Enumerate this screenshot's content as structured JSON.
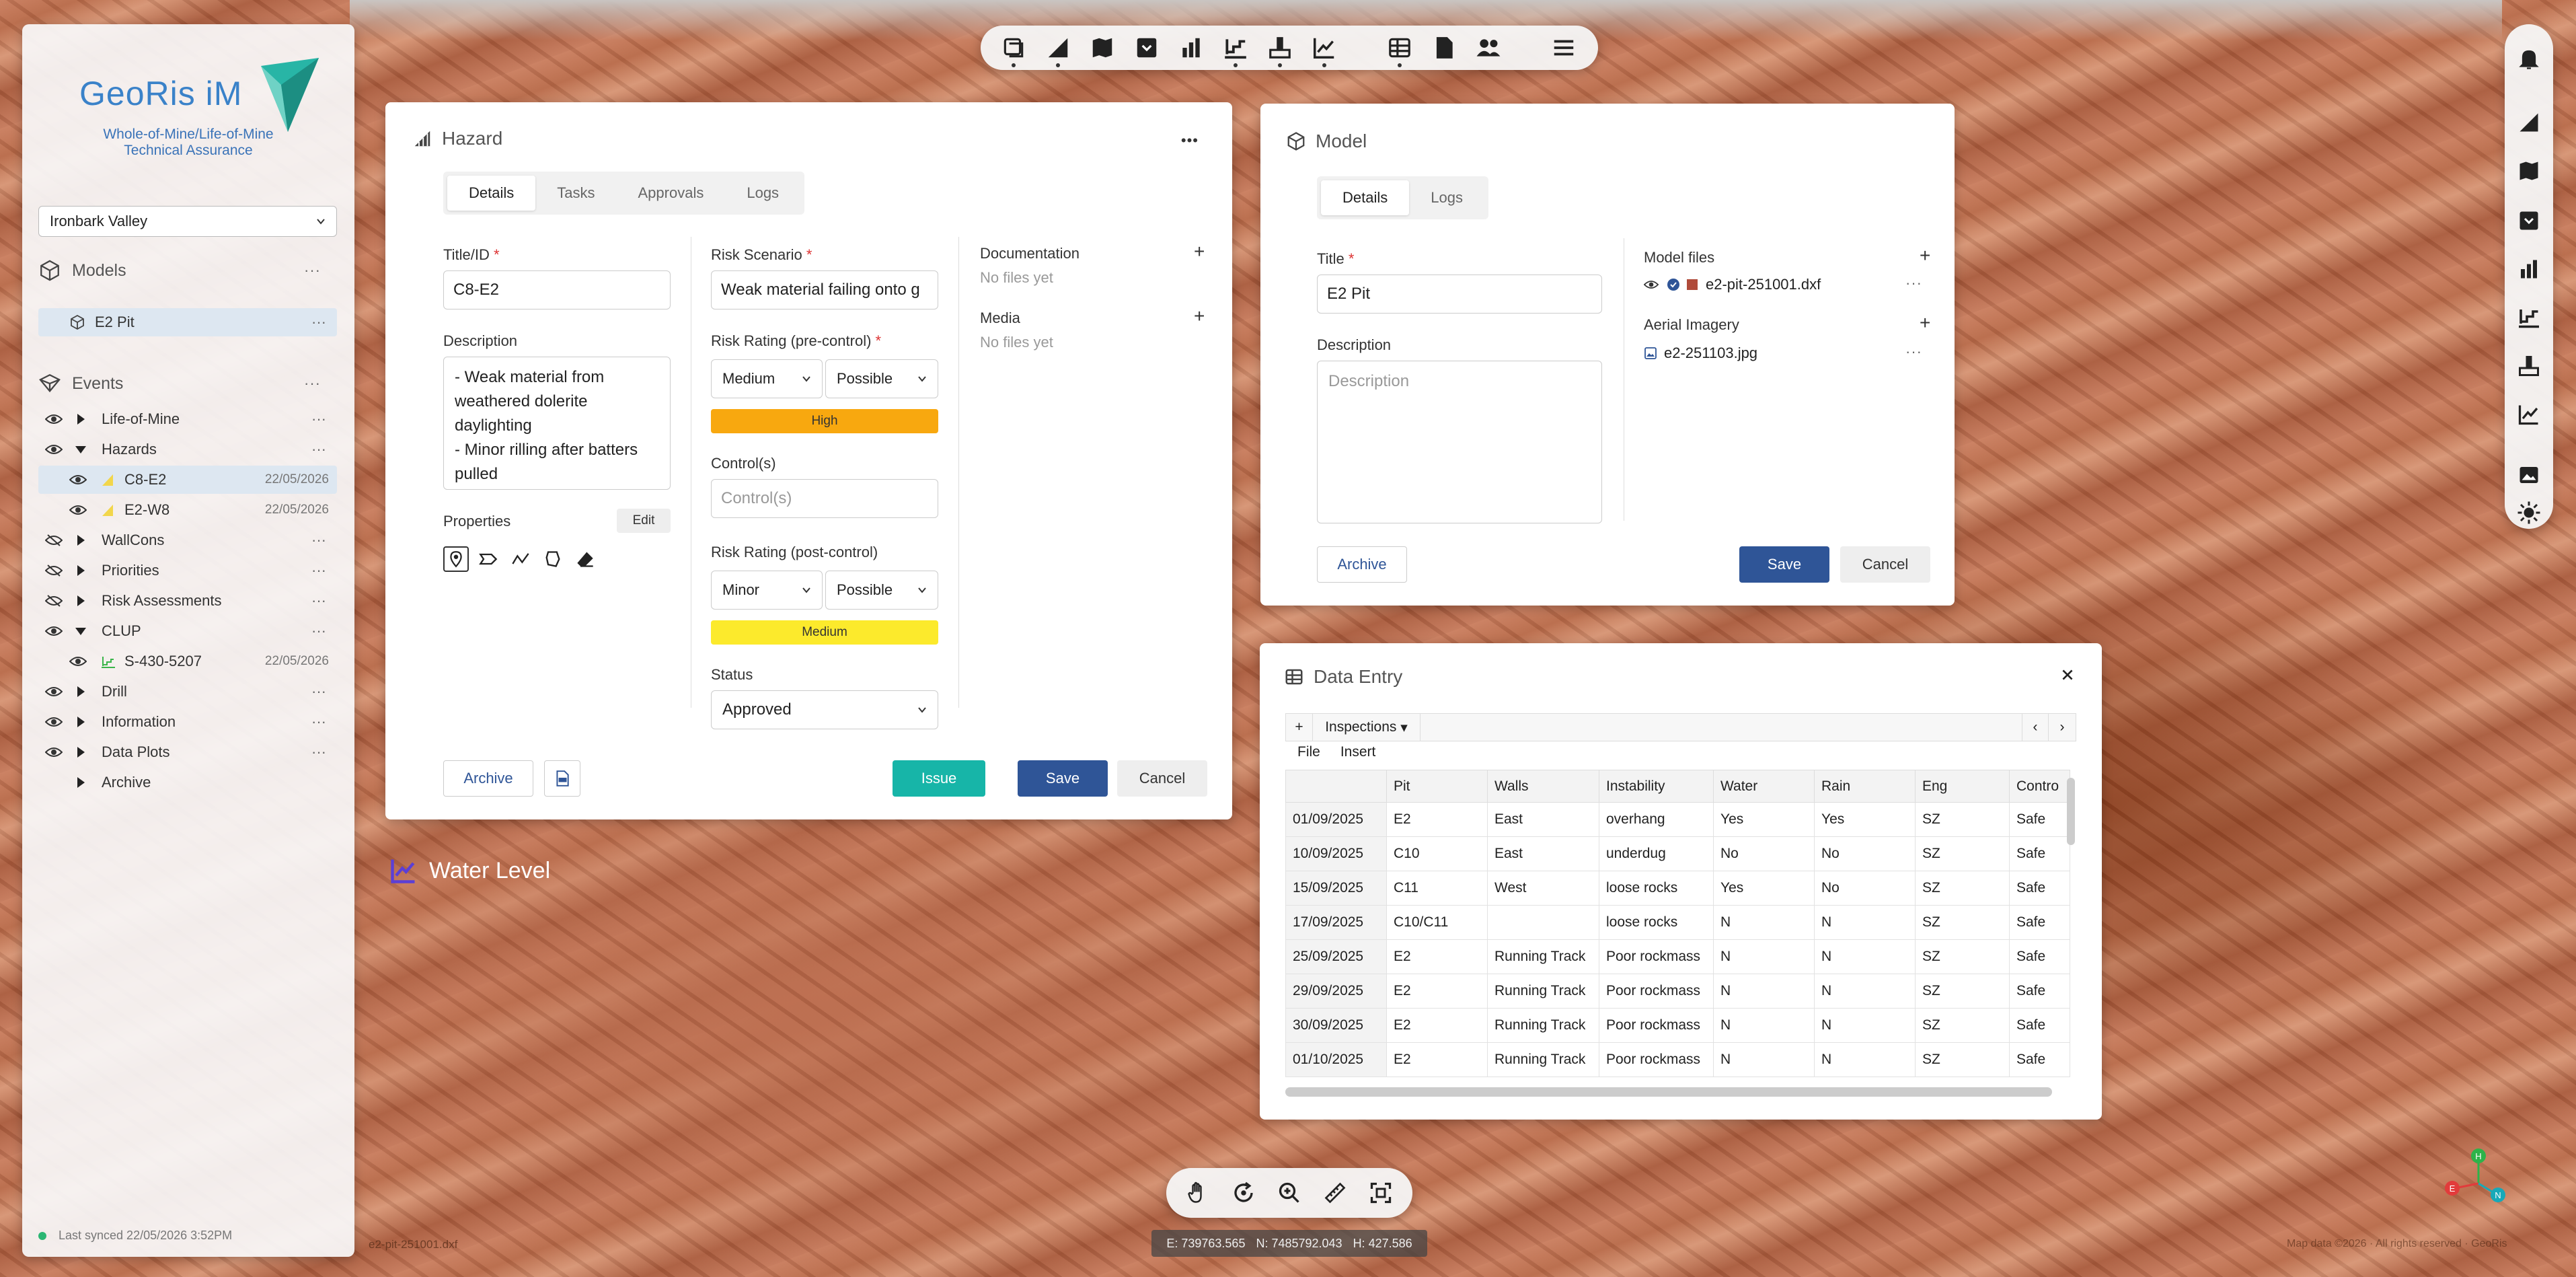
{
  "app": {
    "logo_text": "GeoRis iM",
    "tagline_1": "Whole-of-Mine/Life-of-Mine",
    "tagline_2": "Technical Assurance",
    "site": "Ironbark Valley",
    "sync_status": "Last synced 22/05/2026 3:52PM",
    "file_label": "e2-pit-251001.dxf",
    "copyright": "Map data ©2026 · All rights reserved · GeoRis",
    "water_level_label": "Water Level"
  },
  "sidebar": {
    "models_title": "Models",
    "models": [
      {
        "label": "E2 Pit"
      }
    ],
    "events_title": "Events",
    "events": [
      {
        "label": "Life-of-Mine",
        "date": ""
      },
      {
        "label": "Hazards",
        "date": ""
      },
      {
        "label": "C8-E2",
        "date": "22/05/2026"
      },
      {
        "label": "E2-W8",
        "date": "22/05/2026"
      },
      {
        "label": "WallCons",
        "date": ""
      },
      {
        "label": "Priorities",
        "date": ""
      },
      {
        "label": "Risk Assessments",
        "date": ""
      },
      {
        "label": "CLUP",
        "date": ""
      },
      {
        "label": "S-430-5207",
        "date": "22/05/2026"
      },
      {
        "label": "Drill",
        "date": ""
      },
      {
        "label": "Information",
        "date": ""
      },
      {
        "label": "Data Plots",
        "date": ""
      },
      {
        "label": "Archive",
        "date": ""
      }
    ]
  },
  "coords": {
    "e": "E: 739763.565",
    "n": "N: 7485792.043",
    "h": "H: 427.586"
  },
  "compass": {
    "h": "H",
    "e": "E",
    "n": "N"
  },
  "hazard": {
    "title": "Hazard",
    "menu": "•••",
    "tabs": [
      "Details",
      "Tasks",
      "Approvals",
      "Logs"
    ],
    "title_id_label": "Title/ID",
    "title_id_value": "C8-E2",
    "description_label": "Description",
    "description_value": "- Weak material from weathered dolerite daylighting\n- Minor rilling after batters pulled",
    "properties_label": "Properties",
    "edit_label": "Edit",
    "risk_scenario_label": "Risk Scenario",
    "risk_scenario_value": "Weak material failing onto g",
    "pre_label": "Risk Rating (pre-control)",
    "pre_consequence": "Medium",
    "pre_likelihood": "Possible",
    "pre_rating": "High",
    "controls_label": "Control(s)",
    "controls_placeholder": "Control(s)",
    "post_label": "Risk Rating (post-control)",
    "post_consequence": "Minor",
    "post_likelihood": "Possible",
    "post_rating": "Medium",
    "status_label": "Status",
    "status_value": "Approved",
    "documentation_label": "Documentation",
    "documentation_empty": "No files yet",
    "media_label": "Media",
    "media_empty": "No files yet",
    "archive_label": "Archive",
    "issue_label": "Issue",
    "save_label": "Save",
    "cancel_label": "Cancel",
    "colors": {
      "high": "#f8a80f",
      "medium": "#fcea2c"
    }
  },
  "model": {
    "title": "Model",
    "tabs": [
      "Details",
      "Logs"
    ],
    "title_label": "Title",
    "title_value": "E2 Pit",
    "description_label": "Description",
    "description_placeholder": "Description",
    "model_files_label": "Model files",
    "model_file": "e2-pit-251001.dxf",
    "aerial_label": "Aerial Imagery",
    "aerial_file": "e2-251103.jpg",
    "archive_label": "Archive",
    "save_label": "Save",
    "cancel_label": "Cancel"
  },
  "data_entry": {
    "title": "Data Entry",
    "add_label": "+",
    "sheet_label": "Inspections",
    "menu": [
      "File",
      "Insert"
    ],
    "columns": [
      "Pit",
      "Walls",
      "Instability",
      "Water",
      "Rain",
      "Eng",
      "Contro"
    ],
    "rows": [
      [
        "01/09/2025",
        "E2",
        "East",
        "overhang",
        "Yes",
        "Yes",
        "SZ",
        "Safe"
      ],
      [
        "10/09/2025",
        "C10",
        "East",
        "underdug",
        "No",
        "No",
        "SZ",
        "Safe"
      ],
      [
        "15/09/2025",
        "C11",
        "West",
        "loose rocks",
        "Yes",
        "No",
        "SZ",
        "Safe"
      ],
      [
        "17/09/2025",
        "C10/C11",
        "",
        "loose rocks",
        "N",
        "N",
        "SZ",
        "Safe"
      ],
      [
        "25/09/2025",
        "E2",
        "Running Track",
        "Poor rockmass",
        "N",
        "N",
        "SZ",
        "Safe"
      ],
      [
        "29/09/2025",
        "E2",
        "Running Track",
        "Poor rockmass",
        "N",
        "N",
        "SZ",
        "Safe"
      ],
      [
        "30/09/2025",
        "E2",
        "Running Track",
        "Poor rockmass",
        "N",
        "N",
        "SZ",
        "Safe"
      ],
      [
        "01/10/2025",
        "E2",
        "Running Track",
        "Poor rockmass",
        "N",
        "N",
        "SZ",
        "Safe"
      ]
    ]
  }
}
